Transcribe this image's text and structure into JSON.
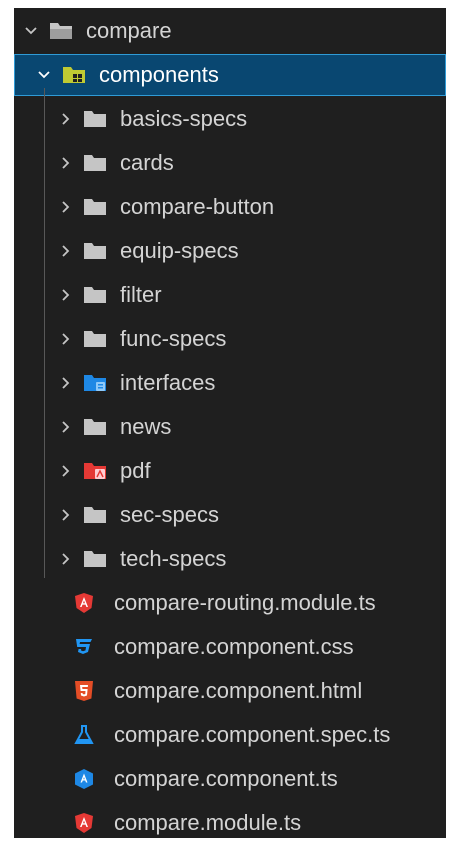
{
  "explorer": {
    "root": {
      "label": "compare",
      "expanded": true
    },
    "components": {
      "label": "components",
      "expanded": true,
      "selected": true
    },
    "folders": [
      {
        "label": "basics-specs",
        "icon": "folder-icon",
        "color": "#c5c5c5"
      },
      {
        "label": "cards",
        "icon": "folder-icon",
        "color": "#c5c5c5"
      },
      {
        "label": "compare-button",
        "icon": "folder-icon",
        "color": "#c5c5c5"
      },
      {
        "label": "equip-specs",
        "icon": "folder-icon",
        "color": "#c5c5c5"
      },
      {
        "label": "filter",
        "icon": "folder-icon",
        "color": "#c5c5c5"
      },
      {
        "label": "func-specs",
        "icon": "folder-icon",
        "color": "#c5c5c5"
      },
      {
        "label": "interfaces",
        "icon": "folder-interfaces-icon",
        "color": "#1e88e5"
      },
      {
        "label": "news",
        "icon": "folder-icon",
        "color": "#c5c5c5"
      },
      {
        "label": "pdf",
        "icon": "folder-pdf-icon",
        "color": "#e53935"
      },
      {
        "label": "sec-specs",
        "icon": "folder-icon",
        "color": "#c5c5c5"
      },
      {
        "label": "tech-specs",
        "icon": "folder-icon",
        "color": "#c5c5c5"
      }
    ],
    "files": [
      {
        "label": "compare-routing.module.ts",
        "icon": "angular-icon",
        "color": "#e53935"
      },
      {
        "label": "compare.component.css",
        "icon": "css-icon",
        "color": "#2196f3"
      },
      {
        "label": "compare.component.html",
        "icon": "html-icon",
        "color": "#e44d26"
      },
      {
        "label": "compare.component.spec.ts",
        "icon": "test-flask-icon",
        "color": "#2196f3"
      },
      {
        "label": "compare.component.ts",
        "icon": "angular-component-icon",
        "color": "#1e88e5"
      },
      {
        "label": "compare.module.ts",
        "icon": "angular-icon",
        "color": "#e53935"
      }
    ]
  }
}
